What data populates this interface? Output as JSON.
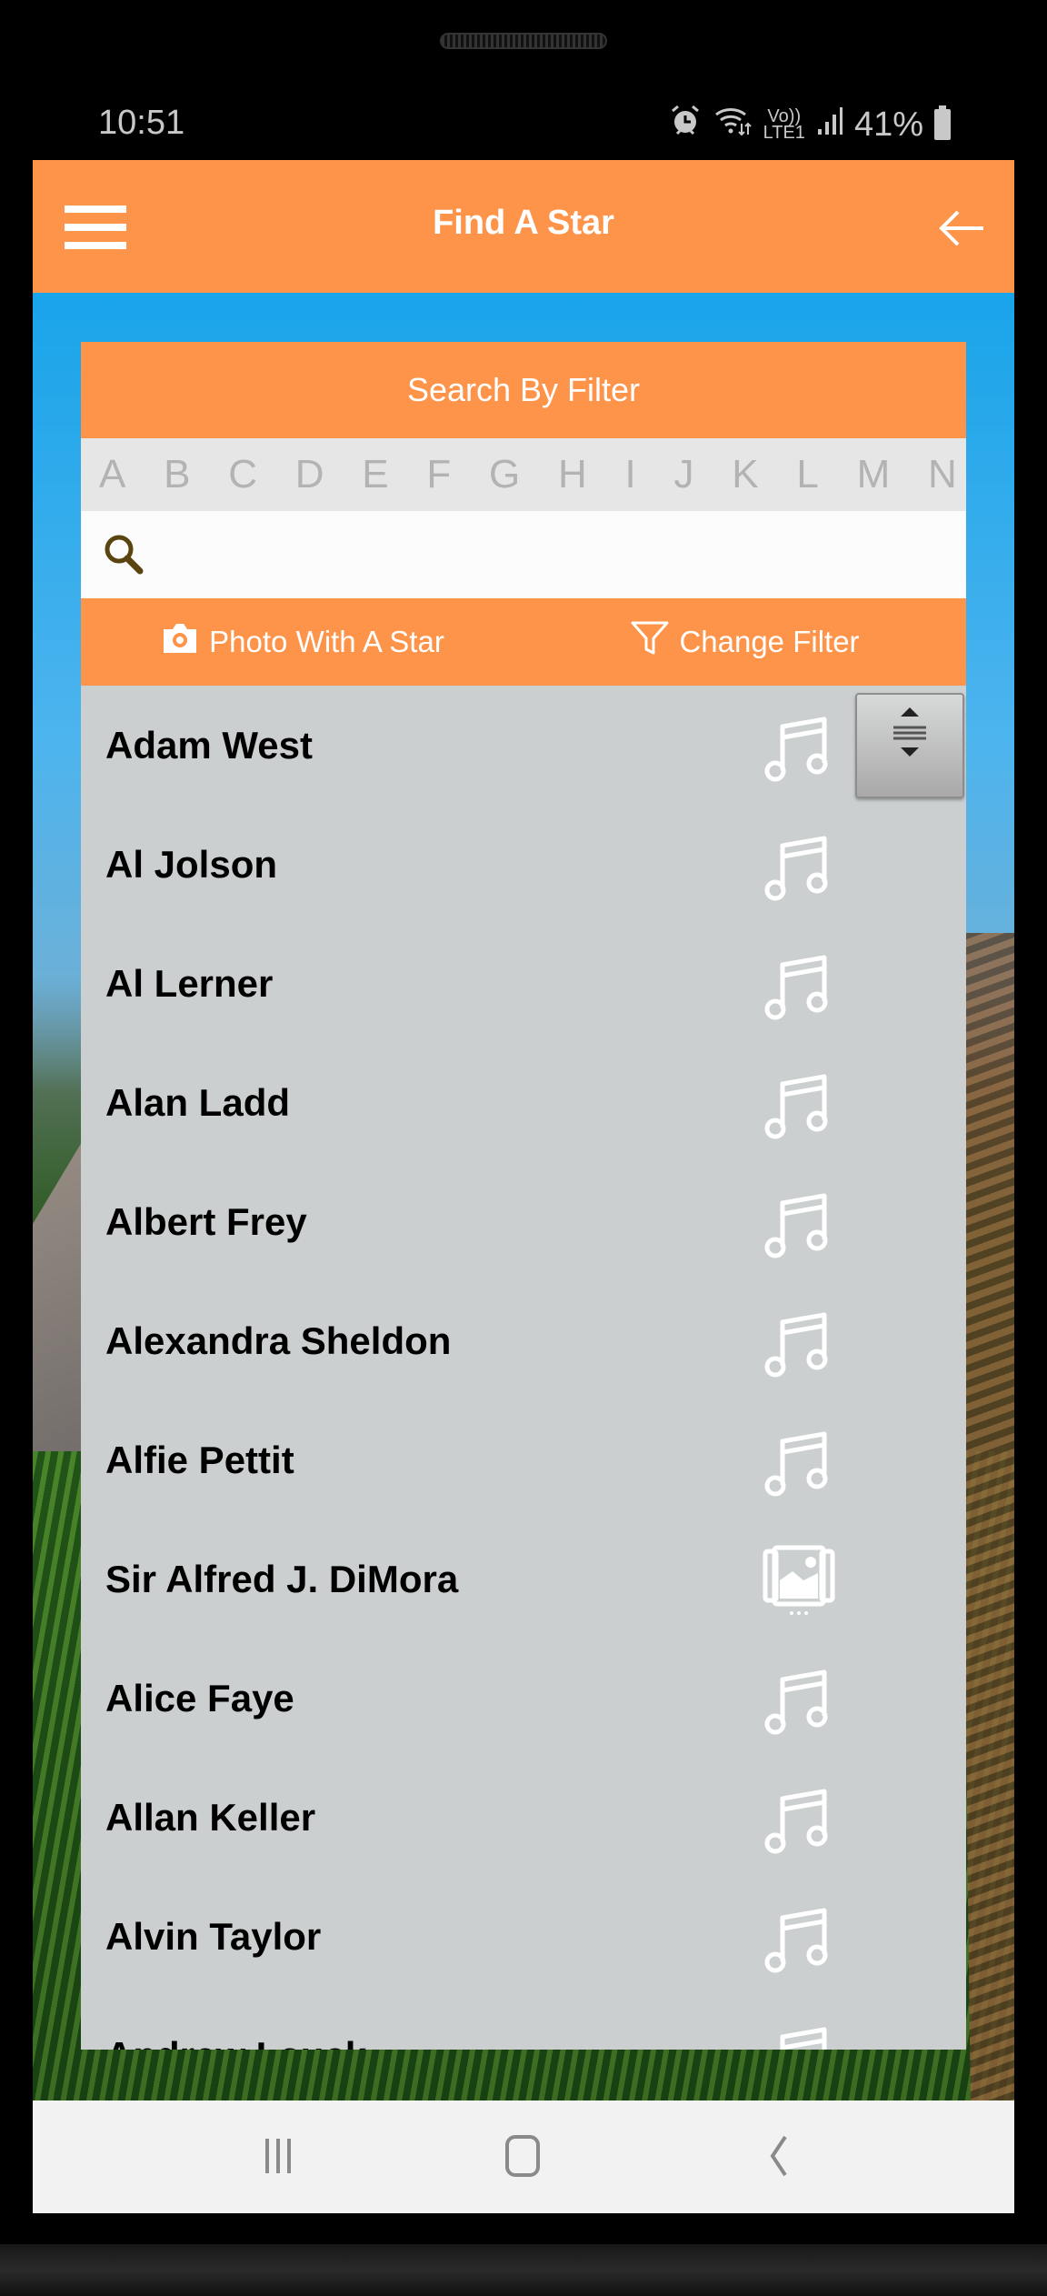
{
  "status_bar": {
    "time": "10:51",
    "volte_label": "Vo))",
    "lte_label": "LTE1",
    "battery_percent": "41%",
    "icons": [
      "alarm-icon",
      "wifi-icon",
      "volte-icon",
      "signal-icon",
      "battery-charging-icon"
    ]
  },
  "app_bar": {
    "title": "Find A Star",
    "left_icon": "hamburger-menu-icon",
    "right_icon": "back-arrow-icon"
  },
  "filter": {
    "header": "Search By Filter",
    "alphabet": [
      "A",
      "B",
      "C",
      "D",
      "E",
      "F",
      "G",
      "H",
      "I",
      "J",
      "K",
      "L",
      "M",
      "N"
    ],
    "search_value": "",
    "search_placeholder": ""
  },
  "actions": {
    "photo_label": "Photo With A Star",
    "photo_icon": "camera-icon",
    "change_filter_label": "Change Filter",
    "change_filter_icon": "filter-funnel-icon"
  },
  "stars": [
    {
      "name": "Adam West",
      "icon": "music-note-icon"
    },
    {
      "name": "Al Jolson",
      "icon": "music-note-icon"
    },
    {
      "name": "Al Lerner",
      "icon": "music-note-icon"
    },
    {
      "name": "Alan Ladd",
      "icon": "music-note-icon"
    },
    {
      "name": "Albert Frey",
      "icon": "music-note-icon"
    },
    {
      "name": "Alexandra Sheldon",
      "icon": "music-note-icon"
    },
    {
      "name": "Alfie Pettit",
      "icon": "music-note-icon"
    },
    {
      "name": "Sir Alfred J. DiMora",
      "icon": "photo-gallery-icon"
    },
    {
      "name": "Alice Faye",
      "icon": "music-note-icon"
    },
    {
      "name": "Allan Keller",
      "icon": "music-note-icon"
    },
    {
      "name": "Alvin Taylor",
      "icon": "music-note-icon"
    },
    {
      "name": "Andrew Lauck",
      "icon": "music-note-icon"
    }
  ],
  "colors": {
    "accent_orange": "#fd944a",
    "list_bg": "#cbcfd0",
    "alphabet_bg": "#e6e6e6",
    "alphabet_text": "#b3b3b3",
    "search_icon": "#5a4510"
  },
  "nav_bar": {
    "buttons": [
      "recent-apps-icon",
      "home-icon",
      "back-icon"
    ]
  }
}
